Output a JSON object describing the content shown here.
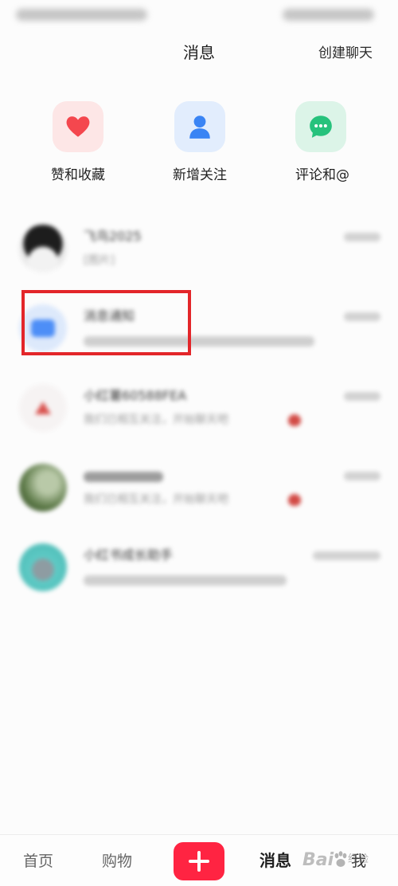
{
  "header": {
    "title": "消息",
    "create_chat_label": "创建聊天"
  },
  "shortcuts": [
    {
      "label": "赞和收藏",
      "icon": "heart-icon",
      "icon_color": "#f4474e",
      "tile_bg": "#fde6e6"
    },
    {
      "label": "新增关注",
      "icon": "person-icon",
      "icon_color": "#3a84f4",
      "tile_bg": "#e2edfd"
    },
    {
      "label": "评论和@",
      "icon": "chat-bubble-icon",
      "icon_color": "#26c27c",
      "tile_bg": "#dcf4e8"
    }
  ],
  "conversations": [
    {
      "title": "飞鸟2025",
      "preview": "[图片]",
      "avatar": "cartoon-avatar"
    },
    {
      "title": "消息通知",
      "avatar": "message-notice-avatar",
      "highlighted": true
    },
    {
      "title": "小红薯60588FEA",
      "preview": "我们已相互关注，开始聊天吧",
      "avatar": "watermelon-avatar",
      "trailing_icon": "red-emoji-icon"
    },
    {
      "preview": "我们已相互关注，开始聊天吧",
      "avatar": "photo-avatar",
      "trailing_icon": "red-emoji-icon"
    },
    {
      "title": "小红书成长助手",
      "avatar": "assistant-avatar"
    }
  ],
  "bottom_nav": {
    "home_label": "首页",
    "shop_label": "购物",
    "post_icon": "plus-icon",
    "messages_label": "消息",
    "me_label": "我"
  },
  "watermark": {
    "logo_text": "Bai",
    "paw_icon": "paw-icon",
    "suffix": "经验"
  },
  "colors": {
    "accent": "#ff2442",
    "highlight_box": "#e3262a",
    "active_nav": "#1e1e1e",
    "inactive_nav": "#666666"
  }
}
